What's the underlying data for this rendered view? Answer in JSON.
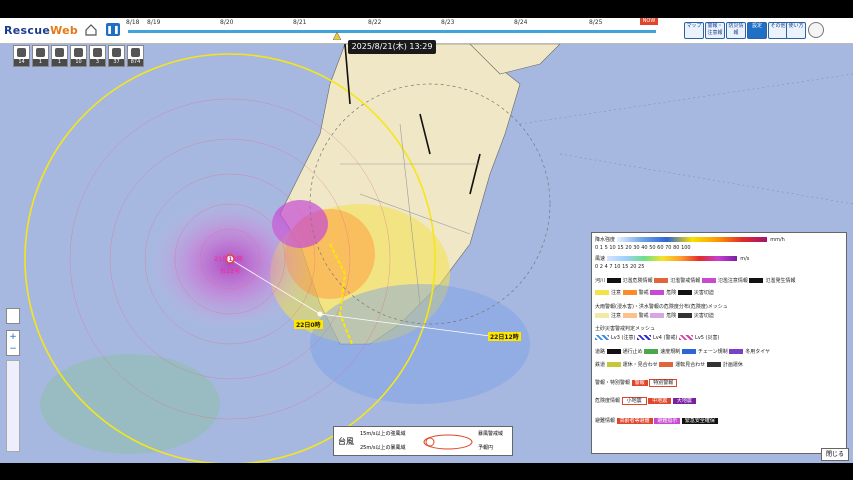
{
  "app": {
    "logo_main": "Rescue",
    "logo_accent": "Web"
  },
  "timeline": {
    "ticks": [
      "8/18",
      "8/19",
      "8/20",
      "8/21",
      "8/22",
      "8/23",
      "8/24",
      "8/25"
    ],
    "now_badge": "NOW"
  },
  "datetime": "2025/8/21(木) 13:29",
  "toolbar": {
    "buttons": [
      {
        "label": "マップ",
        "icon": "map-icon"
      },
      {
        "label": "警報・注意報",
        "icon": "alert-icon"
      },
      {
        "label": "防災情報",
        "icon": "info-icon"
      },
      {
        "label": "設定",
        "icon": "gear-icon"
      },
      {
        "label": "その他",
        "icon": "menu-icon"
      },
      {
        "label": "使い方",
        "icon": "help-icon"
      }
    ]
  },
  "layer_icons": [
    {
      "icon": "train-icon",
      "count": "14"
    },
    {
      "icon": "gear-icon",
      "count": "1"
    },
    {
      "icon": "gear-icon",
      "count": "1"
    },
    {
      "icon": "antenna-icon",
      "count": "10"
    },
    {
      "icon": "tower-icon",
      "count": "3"
    },
    {
      "icon": "person-icon",
      "count": "37"
    },
    {
      "icon": "road-icon",
      "count": "874"
    }
  ],
  "map_labels": {
    "typhoon_pos": "21日13時",
    "typhoon_num": "台12号",
    "forecast_22_00": "22日0時",
    "forecast_22_12": "22日12時"
  },
  "legend": {
    "rain_title": "降水強度",
    "rain_scale": [
      "0",
      "1",
      "5",
      "10",
      "15",
      "20",
      "30",
      "40",
      "50",
      "60",
      "70",
      "80",
      "100"
    ],
    "rain_unit": "mm/h",
    "wind_title": "風速",
    "wind_scale": [
      "0",
      "2",
      "4",
      "7",
      "10",
      "15",
      "20",
      "25"
    ],
    "wind_unit": "m/s",
    "river_title": "河川",
    "river_items": [
      "氾濫危険情報",
      "氾濫警戒情報",
      "氾濫注意情報",
      "氾濫発生情報"
    ],
    "warning_items": [
      "注意",
      "警戒",
      "危険",
      "災害切迫"
    ],
    "mesh_title": "大雨警報(浸水害)・洪水警報の危険度分布(危険度)メッシュ",
    "mesh_items": [
      "注意",
      "警戒",
      "危険",
      "災害切迫"
    ],
    "landslide_title": "土砂災害警戒判定メッシュ",
    "landslide_items": [
      "Lv3 (注意)",
      "Lv4 (警戒)",
      "Lv5 (災害)"
    ],
    "road_title": "道路",
    "road_items": [
      "通行止め",
      "速度規制",
      "チェーン規制",
      "冬用タイヤ"
    ],
    "rail_title": "鉄道",
    "rail_items": [
      "運休・見合わせ",
      "運転見合わせ",
      "計画運休"
    ],
    "alert_title": "警報・特別警報",
    "alert_items": [
      "警報",
      "特別警報"
    ],
    "hazard_title": "危険度情報",
    "hazard_items": [
      "小地震",
      "中地震",
      "大地震"
    ],
    "area_title": "避難情報",
    "area_items": [
      "高齢者等避難",
      "避難指示",
      "緊急安全確保"
    ]
  },
  "typhoon_legend": {
    "title": "台風",
    "items": [
      "15m/s以上の強風域",
      "25m/s以上の暴風域",
      "暴風警戒域",
      "予報円"
    ]
  },
  "close_label": "閉じる",
  "colors": {
    "accent": "#1f6fc5",
    "typhoon_track": "#ffe600",
    "alert_red": "#e0462b"
  }
}
